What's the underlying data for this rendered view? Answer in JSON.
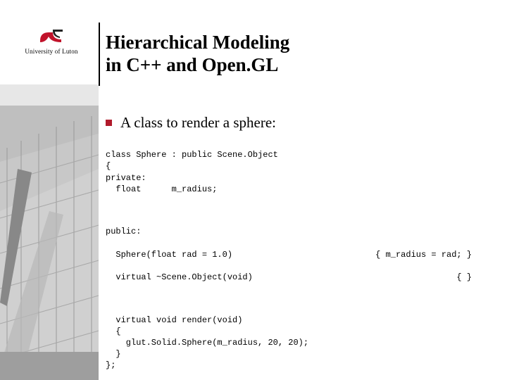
{
  "logo": {
    "text": "University of Luton",
    "icon_name": "luton-logo"
  },
  "title": {
    "line1": "Hierarchical Modeling",
    "line2": "in C++ and Open.GL"
  },
  "bullet": {
    "text": "A class to render a sphere:"
  },
  "code": {
    "block1": "class Sphere : public Scene.Object\n{\nprivate:\n  float      m_radius;",
    "public_label": "public:",
    "ctor_left": "  Sphere(float rad = 1.0)",
    "ctor_right": "{ m_radius = rad; }",
    "dtor_left": "  virtual ~Scene.Object(void)",
    "dtor_right": "{ }",
    "block2": "  virtual void render(void)\n  {\n    glut.Solid.Sphere(m_radius, 20, 20);\n  }\n};"
  }
}
